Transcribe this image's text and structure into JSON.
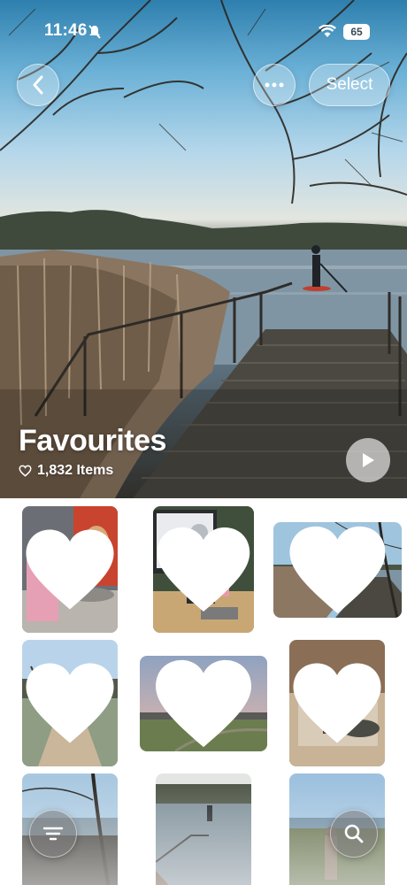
{
  "status_bar": {
    "time": "11:46",
    "battery": "65"
  },
  "header": {
    "select_label": "Select"
  },
  "album": {
    "title": "Favourites",
    "item_count": "1,832 Items"
  },
  "colors": {
    "accent_white": "#ffffff",
    "glass": "rgba(255,255,255,0.28)"
  },
  "icons": [
    "chevron-left-icon",
    "ellipsis-icon",
    "play-icon",
    "heart-icon",
    "filter-icon",
    "search-icon",
    "wifi-icon",
    "bell-slash-icon"
  ],
  "photos": [
    {
      "subject": "mannequin and Frida portrait",
      "favourite": true
    },
    {
      "subject": "presentation screen on desk",
      "favourite": true
    },
    {
      "subject": "lake jetty",
      "favourite": true
    },
    {
      "subject": "frosty path",
      "favourite": true
    },
    {
      "subject": "dusk field with moon",
      "favourite": true
    },
    {
      "subject": "person in garden chair",
      "favourite": true
    },
    {
      "subject": "bare trees by water",
      "favourite": false
    },
    {
      "subject": "paddleboarder on lake",
      "favourite": false
    },
    {
      "subject": "lakeside figure",
      "favourite": false
    }
  ]
}
